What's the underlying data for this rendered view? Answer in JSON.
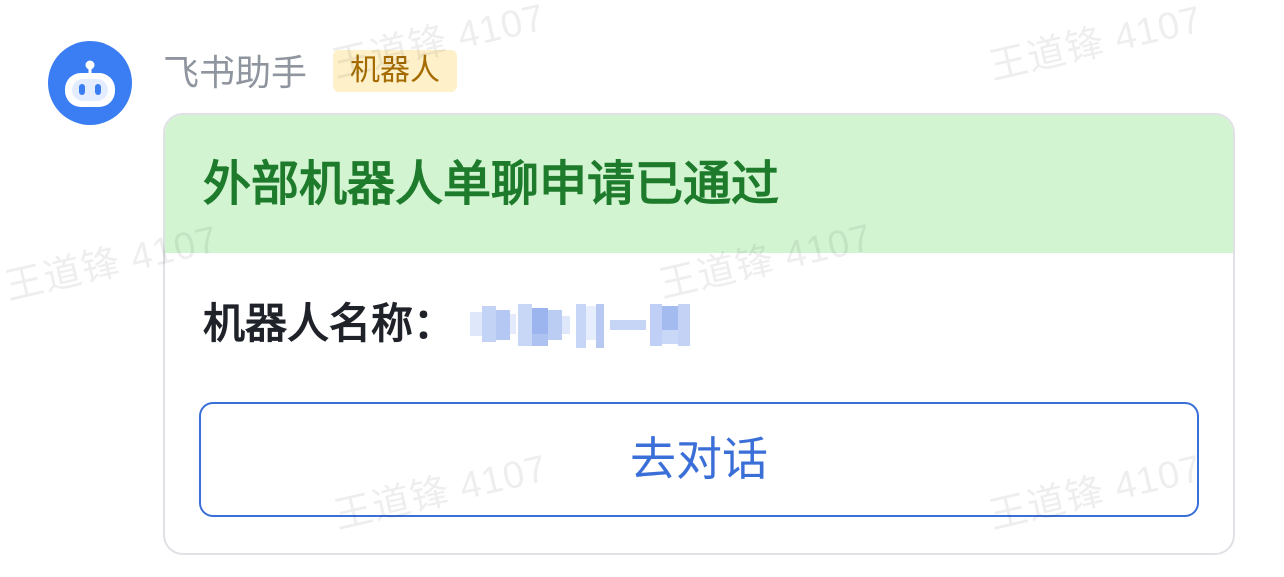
{
  "sender": {
    "name": "飞书助手",
    "badge": "机器人",
    "avatar_icon": "robot-icon"
  },
  "card": {
    "header": {
      "title": "外部机器人单聊申请已通过"
    },
    "field": {
      "label": "机器人名称："
    },
    "action_button": {
      "label": "去对话"
    }
  },
  "watermark": {
    "text": "王道锋 4107"
  },
  "colors": {
    "brand_blue": "#3b7df2",
    "badge_bg": "#fef1c9",
    "badge_text": "#a56b00",
    "header_bg": "#d2f4d1",
    "title_green": "#1e7b2c",
    "button_blue": "#3b6fd8"
  }
}
